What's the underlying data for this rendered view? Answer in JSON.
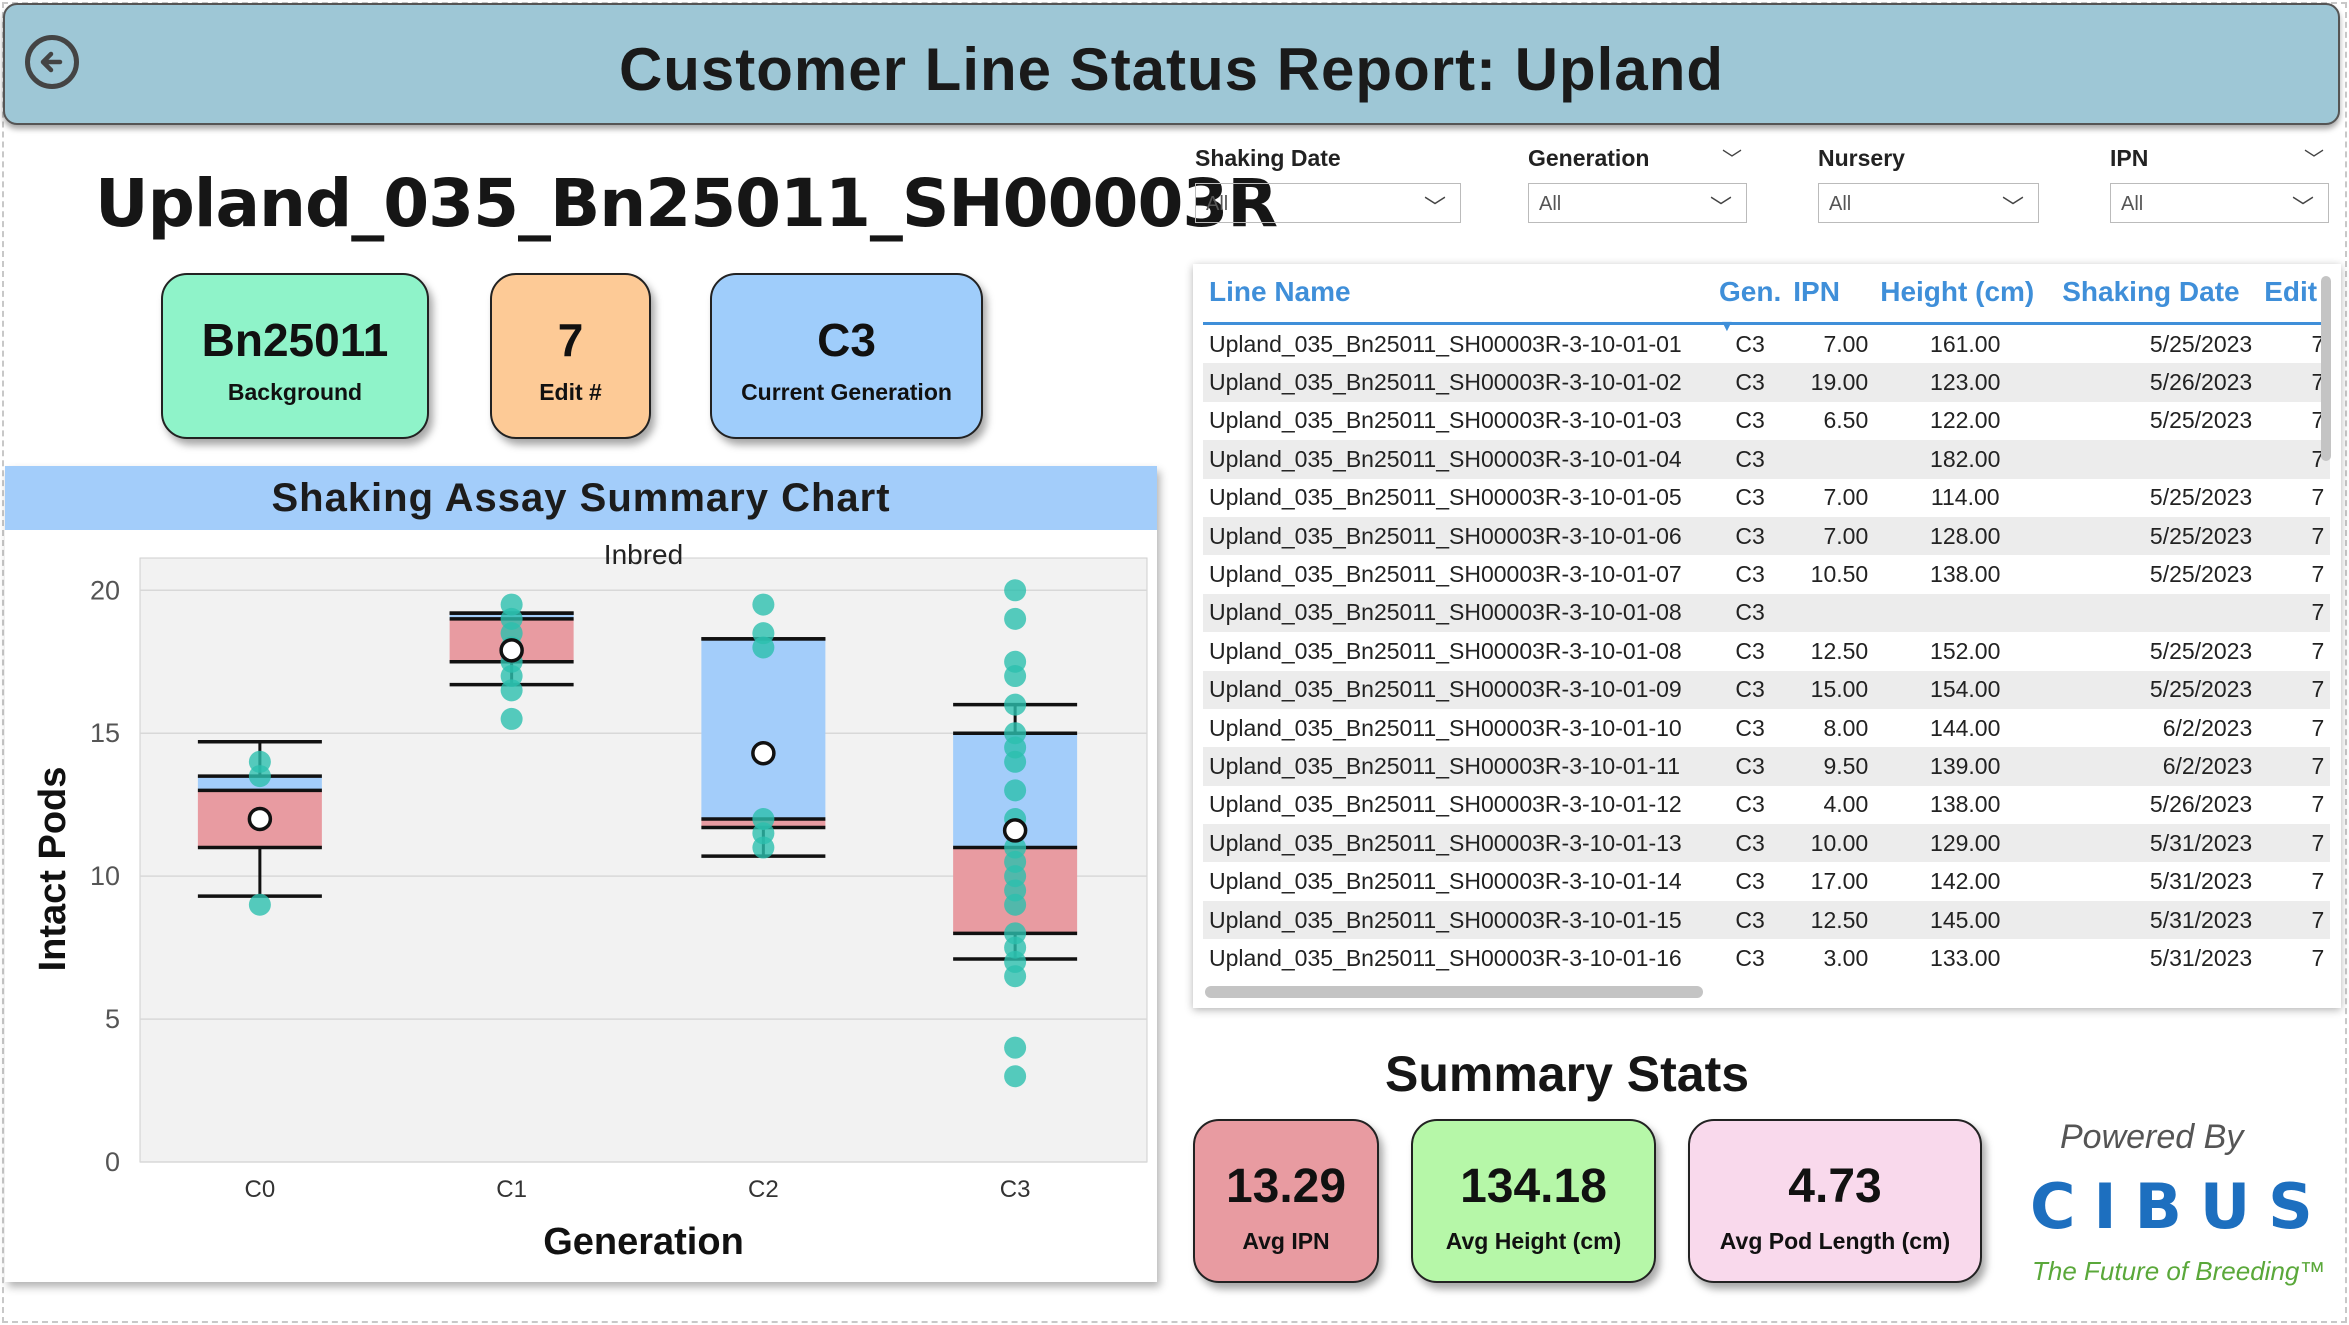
{
  "header": {
    "title": "Customer Line Status Report: Upland",
    "back_icon": "back-arrow-icon"
  },
  "line_name": "Upland_035_Bn25011_SH00003R",
  "cards": [
    {
      "value": "Bn25011",
      "label": "Background",
      "color": "#8ff3c9"
    },
    {
      "value": "7",
      "label": "Edit #",
      "color": "#fdca96"
    },
    {
      "value": "C3",
      "label": "Current Generation",
      "color": "#9fcdfb"
    }
  ],
  "filters": [
    {
      "label": "Shaking Date",
      "value": "All"
    },
    {
      "label": "Generation",
      "value": "All"
    },
    {
      "label": "Nursery",
      "value": "All"
    },
    {
      "label": "IPN",
      "value": "All"
    }
  ],
  "chart_title": "Shaking Assay Summary Chart",
  "chart_data": {
    "type": "boxplot",
    "title": "Inbred",
    "xlabel": "Generation",
    "ylabel": "Intact Pods",
    "categories": [
      "C0",
      "C1",
      "C2",
      "C3"
    ],
    "ylim": [
      0,
      20.5
    ],
    "yticks": [
      0,
      5,
      10,
      15,
      20
    ],
    "boxes": [
      {
        "category": "C0",
        "whisker_low": 9.3,
        "q1": 11,
        "median": 13,
        "q3": 13.5,
        "whisker_high": 14.7,
        "mean": 12,
        "points": [
          9,
          13.5,
          14
        ]
      },
      {
        "category": "C1",
        "whisker_low": 16.7,
        "q1": 17.5,
        "median": 19,
        "q3": 19.2,
        "whisker_high": 19.2,
        "mean": 17.9,
        "points": [
          15.5,
          16.5,
          17,
          17.5,
          18,
          18.5,
          19,
          19.5
        ]
      },
      {
        "category": "C2",
        "whisker_low": 10.7,
        "q1": 11.7,
        "median": 12,
        "q3": 18.3,
        "whisker_high": 18.3,
        "mean": 14.3,
        "points": [
          11,
          11.5,
          12,
          18,
          18.5,
          19.5
        ]
      },
      {
        "category": "C3",
        "whisker_low": 7.1,
        "q1": 8,
        "median": 11,
        "q3": 15,
        "whisker_high": 16,
        "mean": 11.6,
        "points": [
          3,
          4,
          6.5,
          7,
          7.5,
          8,
          9,
          9.5,
          10,
          10.5,
          11,
          12,
          13,
          14,
          14.5,
          15,
          16,
          17,
          17.5,
          19,
          20
        ]
      }
    ],
    "colors": {
      "box_upper": "#a3cdfa",
      "box_lower": "#e89ba1",
      "points": "#2cbfae",
      "plot_bg": "#f2f2f2"
    },
    "grid": true
  },
  "table": {
    "columns": [
      "Line Name",
      "Gen.",
      "IPN",
      "Height (cm)",
      "Shaking Date",
      "Edit"
    ],
    "rows": [
      [
        "Upland_035_Bn25011_SH00003R-3-10-01-01",
        "C3",
        "7.00",
        "161.00",
        "5/25/2023",
        "7"
      ],
      [
        "Upland_035_Bn25011_SH00003R-3-10-01-02",
        "C3",
        "19.00",
        "123.00",
        "5/26/2023",
        "7"
      ],
      [
        "Upland_035_Bn25011_SH00003R-3-10-01-03",
        "C3",
        "6.50",
        "122.00",
        "5/25/2023",
        "7"
      ],
      [
        "Upland_035_Bn25011_SH00003R-3-10-01-04",
        "C3",
        "",
        "182.00",
        "",
        "7"
      ],
      [
        "Upland_035_Bn25011_SH00003R-3-10-01-05",
        "C3",
        "7.00",
        "114.00",
        "5/25/2023",
        "7"
      ],
      [
        "Upland_035_Bn25011_SH00003R-3-10-01-06",
        "C3",
        "7.00",
        "128.00",
        "5/25/2023",
        "7"
      ],
      [
        "Upland_035_Bn25011_SH00003R-3-10-01-07",
        "C3",
        "10.50",
        "138.00",
        "5/25/2023",
        "7"
      ],
      [
        "Upland_035_Bn25011_SH00003R-3-10-01-08",
        "C3",
        "",
        "",
        "",
        "7"
      ],
      [
        "Upland_035_Bn25011_SH00003R-3-10-01-08",
        "C3",
        "12.50",
        "152.00",
        "5/25/2023",
        "7"
      ],
      [
        "Upland_035_Bn25011_SH00003R-3-10-01-09",
        "C3",
        "15.00",
        "154.00",
        "5/25/2023",
        "7"
      ],
      [
        "Upland_035_Bn25011_SH00003R-3-10-01-10",
        "C3",
        "8.00",
        "144.00",
        "6/2/2023",
        "7"
      ],
      [
        "Upland_035_Bn25011_SH00003R-3-10-01-11",
        "C3",
        "9.50",
        "139.00",
        "6/2/2023",
        "7"
      ],
      [
        "Upland_035_Bn25011_SH00003R-3-10-01-12",
        "C3",
        "4.00",
        "138.00",
        "5/26/2023",
        "7"
      ],
      [
        "Upland_035_Bn25011_SH00003R-3-10-01-13",
        "C3",
        "10.00",
        "129.00",
        "5/31/2023",
        "7"
      ],
      [
        "Upland_035_Bn25011_SH00003R-3-10-01-14",
        "C3",
        "17.00",
        "142.00",
        "5/31/2023",
        "7"
      ],
      [
        "Upland_035_Bn25011_SH00003R-3-10-01-15",
        "C3",
        "12.50",
        "145.00",
        "5/31/2023",
        "7"
      ],
      [
        "Upland_035_Bn25011_SH00003R-3-10-01-16",
        "C3",
        "3.00",
        "133.00",
        "5/31/2023",
        "7"
      ]
    ]
  },
  "summary": {
    "title": "Summary Stats",
    "stats": [
      {
        "value": "13.29",
        "label": "Avg IPN",
        "color": "#e89ba1"
      },
      {
        "value": "134.18",
        "label": "Avg Height (cm)",
        "color": "#b6f7a8"
      },
      {
        "value": "4.73",
        "label": "Avg Pod Length (cm)",
        "color": "#f9d9ec"
      }
    ]
  },
  "branding": {
    "powered_by": "Powered By",
    "logo": "CIBUS",
    "tagline": "The Future of Breeding™"
  }
}
